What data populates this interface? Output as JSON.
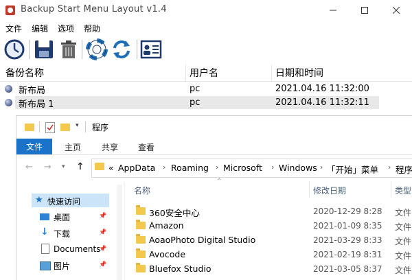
{
  "window": {
    "title": "Backup Start Menu Layout v1.4"
  },
  "menu": [
    "文件",
    "编辑",
    "选项",
    "帮助"
  ],
  "toolbar": {
    "icons": [
      "clock-restore-icon",
      "save-icon",
      "trash-icon",
      "lifebuoy-icon",
      "refresh-icon",
      "contact-card-icon"
    ]
  },
  "list": {
    "columns": [
      "备份名称",
      "用户名",
      "日期和时间"
    ],
    "rows": [
      {
        "name": "新布局",
        "user": "pc",
        "datetime": "2021.04.16 11:32:00"
      },
      {
        "name": "新布局 1",
        "user": "pc",
        "datetime": "2021.04.16 11:32:11"
      }
    ]
  },
  "explorer": {
    "title": "程序",
    "ribbon_tabs": [
      "文件",
      "主页",
      "共享",
      "查看"
    ],
    "breadcrumb": [
      "AppData",
      "Roaming",
      "Microsoft",
      "Windows",
      "「开始」菜单",
      "程序"
    ],
    "breadcrumb_prefix": "«",
    "nav": [
      {
        "label": "快速访问"
      },
      {
        "label": "桌面"
      },
      {
        "label": "下载"
      },
      {
        "label": "Documents"
      },
      {
        "label": "图片"
      }
    ],
    "columns": [
      "名称",
      "修改日期",
      "类型"
    ],
    "files": [
      {
        "name": "360安全中心",
        "date": "2020-12-29 8:28",
        "type": "文件"
      },
      {
        "name": "Amazon",
        "date": "2021-01-09 8:35",
        "type": "文件"
      },
      {
        "name": "AoaoPhoto Digital Studio",
        "date": "2021-03-29 8:33",
        "type": "文件"
      },
      {
        "name": "Avocode",
        "date": "2021-02-19 8:31",
        "type": "文件"
      },
      {
        "name": "Bluefox Studio",
        "date": "2021-03-05 8:37",
        "type": "文件"
      }
    ]
  },
  "colors": {
    "accent": "#1a73c9",
    "selection": "#cce4f7",
    "folder": "#f2c94c"
  }
}
